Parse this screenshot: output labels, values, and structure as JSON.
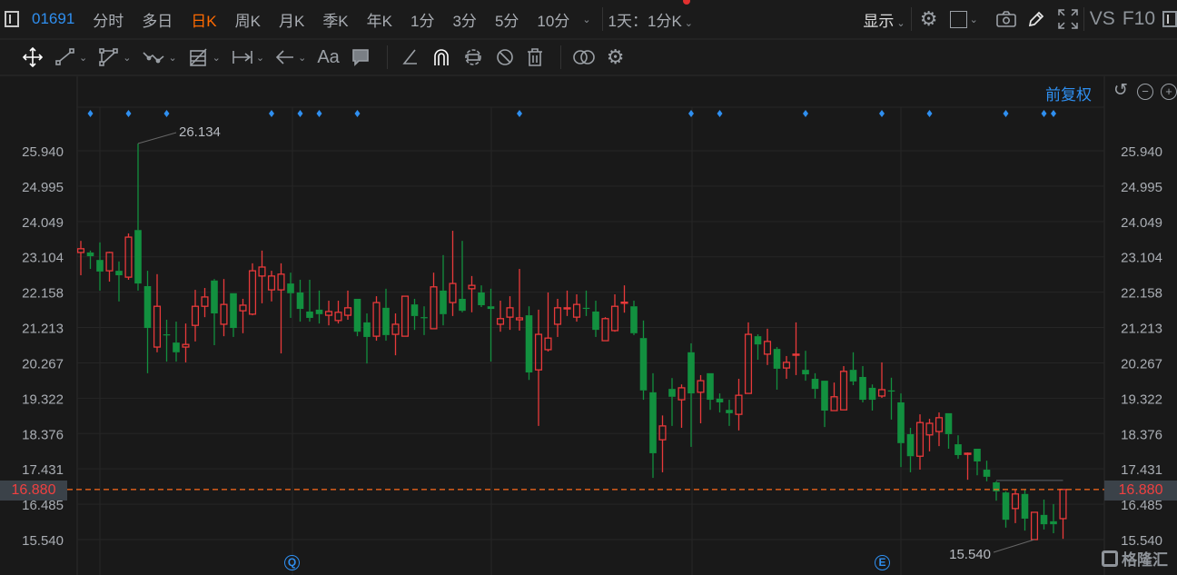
{
  "header": {
    "code": "01691",
    "tabs": [
      "分时",
      "多日",
      "日K",
      "周K",
      "月K",
      "季K",
      "年K",
      "1分",
      "3分",
      "5分",
      "10分"
    ],
    "active_tab": "日K",
    "period_select": "1天：1分K",
    "display_label": "显示",
    "vs_label": "VS",
    "f10_label": "F10"
  },
  "toolbar": {
    "tools": [
      "move-icon",
      "line-icon",
      "polygon-icon",
      "wave-icon",
      "fib-icon",
      "measure-icon",
      "arrow-icon",
      "text-icon",
      "comment-icon",
      "angle-icon",
      "magnet-icon",
      "lock-icon",
      "hide-icon",
      "delete-icon",
      "link-icon",
      "settings-icon"
    ],
    "text_tool_label": "Aa"
  },
  "chart_controls": {
    "adjust_label": "前复权"
  },
  "colors": {
    "up": "#e8393a",
    "down": "#12903f",
    "accent": "#2f8ff0",
    "active": "#ff6a00",
    "price_line": "#ff6a1a"
  },
  "chart_data": {
    "type": "candlestick",
    "y_ticks": [
      "25.940",
      "24.995",
      "24.049",
      "23.104",
      "22.158",
      "21.213",
      "20.267",
      "19.322",
      "18.376",
      "17.431",
      "16.485",
      "15.540"
    ],
    "ylim": [
      15.54,
      25.94
    ],
    "current_price": "16.880",
    "high_label": "26.134",
    "low_label": "15.540",
    "high_index": 6,
    "low_index": 100,
    "event_markers": [
      {
        "index": 22,
        "label": "Q"
      },
      {
        "index": 84,
        "label": "E"
      }
    ],
    "dividend_marker_indices": [
      1,
      5,
      9,
      20,
      23,
      25,
      29,
      46,
      64,
      67,
      76,
      84,
      89,
      97,
      101,
      102
    ],
    "ohlc": [
      [
        23.22,
        23.53,
        22.61,
        23.32
      ],
      [
        23.22,
        23.27,
        22.78,
        23.12
      ],
      [
        23.02,
        23.49,
        22.2,
        22.71
      ],
      [
        22.73,
        23.24,
        22.44,
        23.22
      ],
      [
        22.73,
        22.98,
        21.91,
        22.61
      ],
      [
        22.56,
        23.73,
        22.49,
        23.63
      ],
      [
        23.82,
        26.134,
        22.2,
        22.39
      ],
      [
        22.32,
        22.73,
        19.99,
        21.2
      ],
      [
        20.69,
        22.64,
        20.55,
        21.78
      ],
      [
        21.03,
        21.42,
        20.3,
        21.02
      ],
      [
        20.81,
        21.37,
        20.3,
        20.55
      ],
      [
        20.69,
        21.32,
        20.28,
        20.76
      ],
      [
        21.27,
        22.22,
        20.84,
        21.78
      ],
      [
        21.78,
        22.27,
        21.49,
        22.03
      ],
      [
        22.47,
        22.51,
        20.74,
        21.59
      ],
      [
        21.3,
        22.51,
        20.98,
        21.83
      ],
      [
        22.13,
        22.13,
        20.96,
        21.2
      ],
      [
        21.66,
        21.98,
        21.06,
        21.81
      ],
      [
        21.57,
        22.93,
        21.54,
        22.73
      ],
      [
        22.59,
        23.27,
        21.86,
        22.83
      ],
      [
        22.22,
        22.73,
        21.91,
        22.59
      ],
      [
        22.22,
        22.93,
        20.52,
        22.64
      ],
      [
        22.39,
        22.68,
        21.47,
        22.13
      ],
      [
        22.15,
        22.49,
        21.37,
        21.71
      ],
      [
        21.64,
        22.49,
        21.37,
        21.47
      ],
      [
        21.69,
        22.2,
        21.32,
        21.57
      ],
      [
        21.54,
        21.93,
        21.27,
        21.64
      ],
      [
        21.4,
        21.93,
        21.32,
        21.62
      ],
      [
        21.54,
        22.2,
        21.42,
        21.74
      ],
      [
        21.98,
        21.98,
        20.98,
        21.1
      ],
      [
        21.35,
        21.59,
        20.25,
        20.96
      ],
      [
        20.98,
        22.05,
        20.86,
        21.88
      ],
      [
        21.74,
        22.25,
        20.86,
        21.01
      ],
      [
        21.03,
        21.59,
        20.47,
        21.3
      ],
      [
        20.98,
        22.05,
        20.98,
        22.05
      ],
      [
        21.83,
        21.98,
        21.15,
        21.52
      ],
      [
        21.49,
        21.78,
        21.01,
        21.48
      ],
      [
        21.18,
        22.68,
        21.18,
        22.3
      ],
      [
        22.2,
        23.15,
        21.27,
        21.57
      ],
      [
        21.88,
        23.8,
        21.52,
        22.39
      ],
      [
        21.98,
        23.53,
        21.62,
        21.66
      ],
      [
        22.25,
        22.59,
        21.62,
        22.34
      ],
      [
        22.15,
        22.34,
        21.76,
        21.81
      ],
      [
        21.78,
        22.25,
        20.3,
        21.71
      ],
      [
        21.3,
        21.93,
        21.1,
        21.45
      ],
      [
        21.49,
        22.05,
        21.15,
        21.74
      ],
      [
        21.42,
        22.78,
        21.13,
        21.47
      ],
      [
        21.54,
        21.78,
        19.81,
        20.01
      ],
      [
        20.08,
        21.69,
        18.58,
        21.03
      ],
      [
        20.62,
        22.15,
        20.57,
        20.93
      ],
      [
        21.3,
        21.98,
        20.96,
        21.74
      ],
      [
        21.73,
        22.2,
        21.52,
        21.74
      ],
      [
        21.49,
        22.1,
        21.37,
        21.83
      ],
      [
        21.74,
        22.2,
        21.52,
        21.73
      ],
      [
        21.64,
        21.93,
        20.96,
        21.15
      ],
      [
        20.86,
        21.49,
        20.86,
        21.45
      ],
      [
        21.13,
        22.1,
        21.1,
        21.78
      ],
      [
        21.88,
        22.34,
        21.61,
        21.89
      ],
      [
        21.78,
        21.93,
        21.01,
        21.06
      ],
      [
        20.93,
        21.4,
        19.28,
        19.53
      ],
      [
        19.48,
        19.99,
        17.19,
        17.85
      ],
      [
        18.21,
        18.86,
        17.34,
        18.58
      ],
      [
        19.57,
        19.86,
        18.58,
        19.36
      ],
      [
        19.28,
        19.69,
        18.53,
        19.6
      ],
      [
        20.55,
        20.79,
        18.02,
        19.45
      ],
      [
        19.48,
        19.94,
        18.65,
        19.79
      ],
      [
        19.99,
        19.99,
        19.01,
        19.28
      ],
      [
        19.31,
        19.45,
        18.94,
        19.21
      ],
      [
        19.01,
        19.28,
        18.58,
        18.92
      ],
      [
        18.89,
        19.84,
        18.46,
        19.4
      ],
      [
        19.45,
        21.35,
        19.45,
        21.03
      ],
      [
        20.98,
        21.03,
        20.35,
        20.76
      ],
      [
        20.5,
        21.18,
        20.21,
        20.84
      ],
      [
        20.64,
        20.69,
        19.55,
        20.11
      ],
      [
        20.13,
        20.45,
        19.84,
        20.28
      ],
      [
        20.49,
        21.35,
        19.94,
        20.5
      ],
      [
        20.08,
        20.59,
        19.79,
        19.96
      ],
      [
        19.84,
        19.99,
        19.31,
        19.57
      ],
      [
        19.79,
        19.79,
        18.55,
        18.99
      ],
      [
        18.99,
        19.74,
        18.99,
        19.36
      ],
      [
        19.01,
        20.18,
        19.01,
        20.04
      ],
      [
        20.08,
        20.55,
        19.67,
        19.77
      ],
      [
        19.89,
        20.18,
        19.21,
        19.28
      ],
      [
        19.6,
        19.69,
        18.99,
        19.28
      ],
      [
        19.38,
        20.28,
        19.33,
        19.55
      ],
      [
        19.53,
        19.87,
        18.75,
        19.5
      ],
      [
        19.21,
        19.45,
        17.48,
        18.12
      ],
      [
        18.36,
        18.53,
        17.34,
        17.77
      ],
      [
        17.77,
        18.89,
        17.41,
        18.67
      ],
      [
        18.34,
        18.77,
        17.9,
        18.65
      ],
      [
        18.43,
        18.94,
        18.04,
        18.8
      ],
      [
        18.92,
        18.92,
        17.97,
        18.36
      ],
      [
        18.09,
        18.33,
        17.7,
        17.8
      ],
      [
        17.84,
        17.87,
        17.14,
        17.85
      ],
      [
        17.97,
        17.97,
        17.26,
        17.63
      ],
      [
        17.41,
        17.65,
        17.1,
        17.22
      ],
      [
        17.07,
        17.1,
        16.58,
        16.83
      ],
      [
        16.8,
        16.83,
        15.86,
        16.07
      ],
      [
        16.37,
        16.88,
        15.98,
        16.76
      ],
      [
        16.76,
        16.88,
        15.78,
        16.1
      ],
      [
        15.54,
        16.27,
        15.54,
        16.27
      ],
      [
        16.2,
        16.61,
        15.81,
        15.95
      ],
      [
        16.03,
        16.49,
        15.71,
        15.95
      ],
      [
        16.1,
        16.88,
        15.56,
        16.88
      ]
    ]
  },
  "watermark": "格隆汇"
}
